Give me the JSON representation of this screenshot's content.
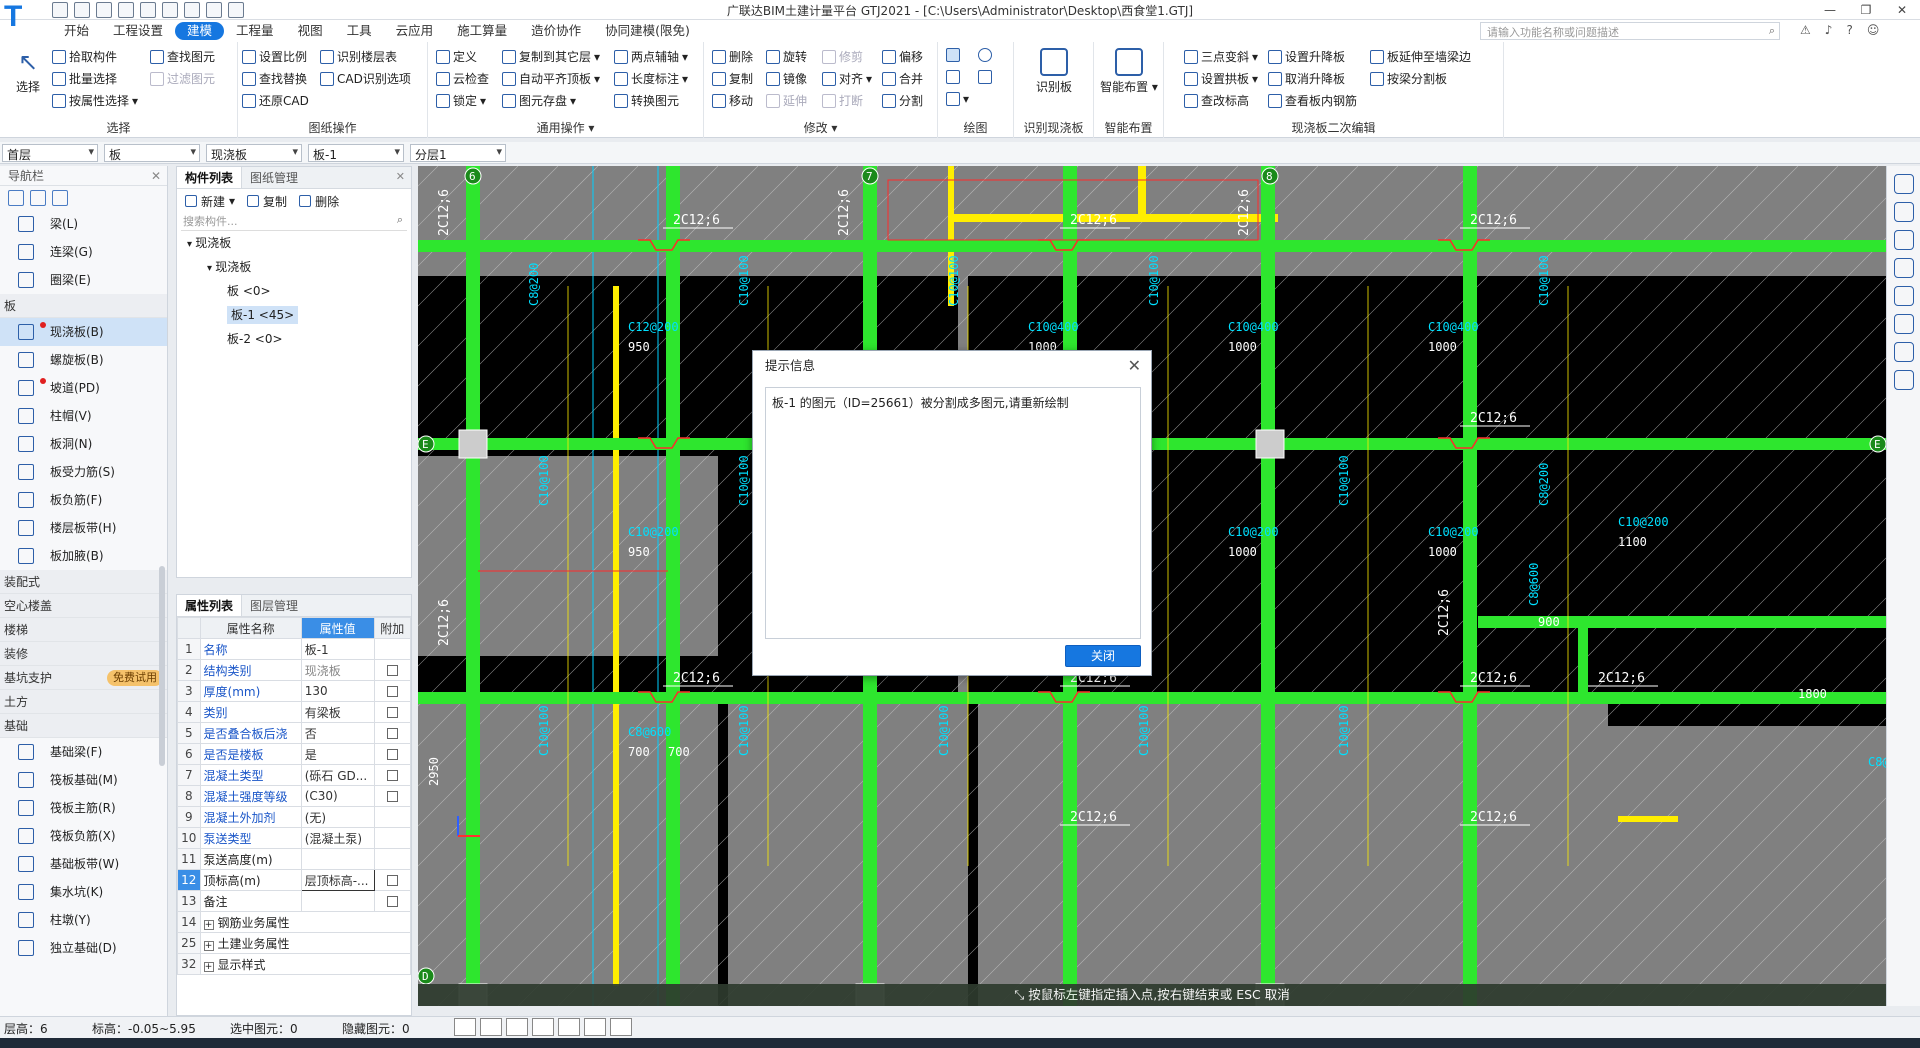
{
  "window": {
    "title": "广联达BIM土建计量平台 GTJ2021 - [C:\\Users\\Administrator\\Desktop\\西食堂1.GTJ]",
    "logo": "T"
  },
  "menu": {
    "items": [
      "开始",
      "工程设置",
      "建模",
      "工程量",
      "视图",
      "工具",
      "云应用",
      "施工算量",
      "造价协作",
      "协同建模(限免)"
    ],
    "active_index": 2,
    "search_placeholder": "请输入功能名称或问题描述"
  },
  "ribbon": {
    "select": {
      "label": "选择",
      "big": "选择",
      "items": [
        "拾取构件",
        "批量选择",
        "按属性选择",
        "查找图元",
        "过滤图元"
      ]
    },
    "drawing_ops": {
      "label": "图纸操作",
      "items": [
        "设置比例",
        "识别楼层表",
        "查找替换",
        "CAD识别选项",
        "还原CAD"
      ]
    },
    "general": {
      "label": "通用操作",
      "items": [
        "定义",
        "复制到其它层",
        "两点辅轴",
        "云检查",
        "自动平齐顶板",
        "长度标注",
        "锁定",
        "图元存盘",
        "转换图元"
      ]
    },
    "modify": {
      "label": "修改",
      "items": [
        "删除",
        "旋转",
        "修剪",
        "偏移",
        "复制",
        "镜像",
        "对齐",
        "合并",
        "移动",
        "延伸",
        "打断",
        "分割"
      ]
    },
    "draw": {
      "label": "绘图"
    },
    "recognize": {
      "label": "识别现浇板",
      "big": "识别板"
    },
    "smart": {
      "label": "智能布置",
      "big": "智能布置"
    },
    "secondary": {
      "label": "现浇板二次编辑",
      "items": [
        "三点变斜",
        "设置升降板",
        "板延伸至墙梁边",
        "设置拱板",
        "取消升降板",
        "按梁分割板",
        "查改标高",
        "查看板内钢筋"
      ]
    }
  },
  "selectors": [
    "首层",
    "板",
    "现浇板",
    "板-1",
    "分层1"
  ],
  "nav": {
    "title": "导航栏",
    "groups": [
      {
        "name": "",
        "items": [
          {
            "label": "梁(L)"
          },
          {
            "label": "连梁(G)"
          },
          {
            "label": "圈梁(E)"
          }
        ]
      },
      {
        "name": "板",
        "items": [
          {
            "label": "现浇板(B)",
            "active": true,
            "dot": true
          },
          {
            "label": "螺旋板(B)"
          },
          {
            "label": "坡道(PD)",
            "dot": true
          },
          {
            "label": "柱帽(V)"
          },
          {
            "label": "板洞(N)"
          },
          {
            "label": "板受力筋(S)"
          },
          {
            "label": "板负筋(F)"
          },
          {
            "label": "楼层板带(H)"
          },
          {
            "label": "板加腋(B)"
          }
        ]
      }
    ],
    "collapsed": [
      "装配式",
      "空心楼盖",
      "楼梯",
      "装修",
      "基坑支护",
      "土方"
    ],
    "trial_badge": "免费试用",
    "foundation": {
      "name": "基础",
      "items": [
        "基础梁(F)",
        "筏板基础(M)",
        "筏板主筋(R)",
        "筏板负筋(X)",
        "基础板带(W)",
        "集水坑(K)",
        "柱墩(Y)",
        "独立基础(D)"
      ]
    }
  },
  "components": {
    "tabs": [
      "构件列表",
      "图纸管理"
    ],
    "tools": [
      "新建",
      "复制",
      "删除"
    ],
    "search_placeholder": "搜索构件...",
    "tree": [
      {
        "label": "现浇板",
        "level": 0
      },
      {
        "label": "现浇板",
        "level": 1
      },
      {
        "label": "板 <0>",
        "level": 2
      },
      {
        "label": "板-1 <45>",
        "level": 2,
        "selected": true
      },
      {
        "label": "板-2 <0>",
        "level": 2
      }
    ]
  },
  "properties": {
    "tabs": [
      "属性列表",
      "图层管理"
    ],
    "headers": [
      "属性名称",
      "属性值",
      "附加"
    ],
    "rows": [
      {
        "idx": "1",
        "name": "名称",
        "value": "板-1",
        "blue": true,
        "check": false
      },
      {
        "idx": "2",
        "name": "结构类别",
        "value": "现浇板",
        "blue": true,
        "check": true,
        "gray": true
      },
      {
        "idx": "3",
        "name": "厚度(mm)",
        "value": "130",
        "blue": true,
        "check": true
      },
      {
        "idx": "4",
        "name": "类别",
        "value": "有梁板",
        "blue": true,
        "check": true
      },
      {
        "idx": "5",
        "name": "是否叠合板后浇",
        "value": "否",
        "blue": true,
        "check": true
      },
      {
        "idx": "6",
        "name": "是否是楼板",
        "value": "是",
        "blue": true,
        "check": true
      },
      {
        "idx": "7",
        "name": "混凝土类型",
        "value": "(砾石 GD...",
        "blue": true,
        "check": true
      },
      {
        "idx": "8",
        "name": "混凝土强度等级",
        "value": "(C30)",
        "blue": true,
        "check": true
      },
      {
        "idx": "9",
        "name": "混凝土外加剂",
        "value": "(无)",
        "blue": true,
        "check": false
      },
      {
        "idx": "10",
        "name": "泵送类型",
        "value": "(混凝土泵)",
        "blue": true,
        "check": false
      },
      {
        "idx": "11",
        "name": "泵送高度(m)",
        "value": "",
        "blue": false,
        "check": false
      },
      {
        "idx": "12",
        "name": "顶标高(m)",
        "value": "层顶标高-...",
        "blue": false,
        "check": true,
        "current": true
      },
      {
        "idx": "13",
        "name": "备注",
        "value": "",
        "blue": false,
        "check": true
      },
      {
        "idx": "14",
        "name": "钢筋业务属性",
        "value": "",
        "group": true
      },
      {
        "idx": "25",
        "name": "土建业务属性",
        "value": "",
        "group": true
      },
      {
        "idx": "32",
        "name": "显示样式",
        "value": "",
        "group": true
      }
    ]
  },
  "canvas": {
    "axis_labels": [
      "6",
      "7",
      "8",
      "E",
      "E",
      "D"
    ],
    "rebar_label": "2C12;6",
    "annotations": [
      "C8@200",
      "C10@100",
      "C10@400",
      "1000",
      "C12@200",
      "950",
      "C10@200",
      "C8@600",
      "700",
      "1800",
      "1100",
      "900",
      "2950"
    ],
    "command_hint": "按鼠标左键指定插入点,按右键结束或 ESC 取消"
  },
  "dialog": {
    "title": "提示信息",
    "message": "板-1 的图元（ID=25661）被分割成多图元,请重新绘制",
    "close_button": "关闭"
  },
  "status": {
    "floor_height": "层高：6",
    "elevation": "标高：-0.05~5.95",
    "selected": "选中图元：0",
    "hidden": "隐藏图元：0"
  },
  "colors": {
    "beam_green": "#2ee62e",
    "canvas_bg": "#000000",
    "slab_gray": "#808080",
    "accent_blue": "#1677e0",
    "yellow": "#ffee00"
  }
}
